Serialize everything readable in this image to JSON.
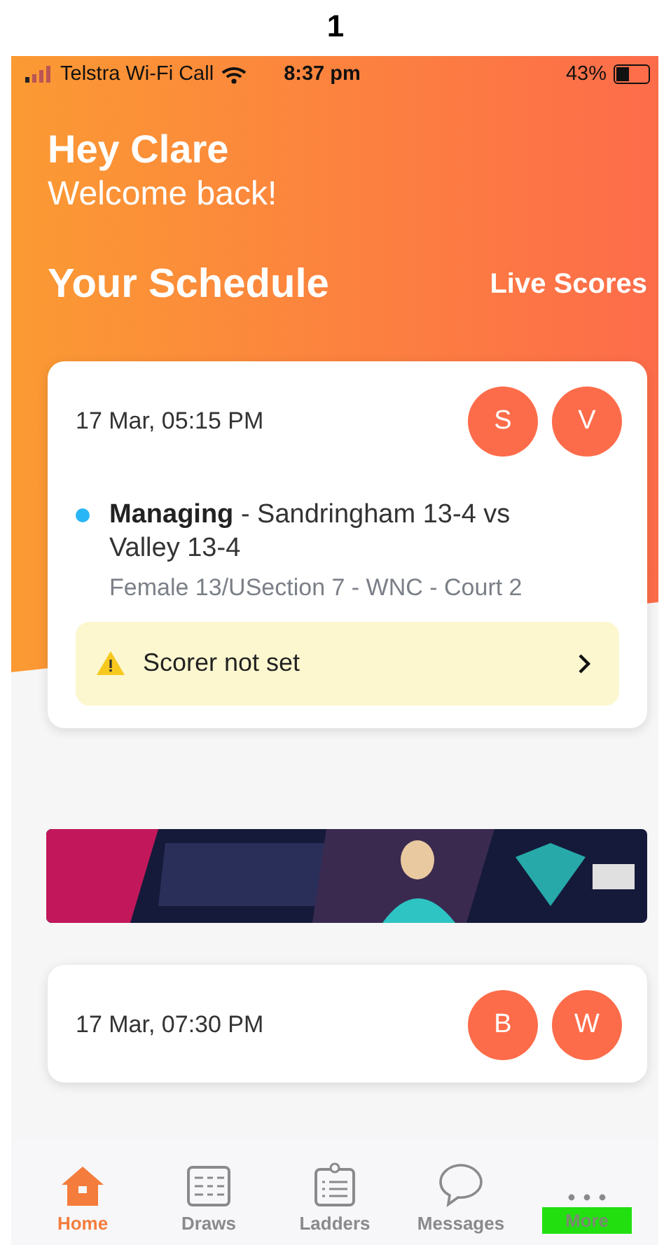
{
  "figure_label": "1",
  "status_bar": {
    "carrier": "Telstra Wi-Fi Call",
    "time": "8:37 pm",
    "battery": "43%"
  },
  "greeting": {
    "title": "Hey Clare",
    "subtitle": "Welcome back!"
  },
  "schedule": {
    "title": "Your Schedule",
    "link": "Live Scores"
  },
  "matches": [
    {
      "datetime": "17 Mar, 05:15 PM",
      "teams": [
        "S",
        "V"
      ],
      "color": "#29b6f6",
      "role": "Managing",
      "fixture": " - Sandringham 13-4 vs Valley 13-4",
      "details": "Female 13/USection 7 - WNC - Court 2",
      "alert": "Scorer not set"
    },
    {
      "datetime": "17 Mar, 07:30 PM",
      "teams": [
        "B",
        "W"
      ]
    }
  ],
  "tabs": [
    {
      "label": "Home",
      "kind": "home",
      "selected": true,
      "highlighted": false
    },
    {
      "label": "Draws",
      "kind": "draws",
      "selected": false,
      "highlighted": false
    },
    {
      "label": "Ladders",
      "kind": "ladders",
      "selected": false,
      "highlighted": false
    },
    {
      "label": "Messages",
      "kind": "messages",
      "selected": false,
      "highlighted": false
    },
    {
      "label": "More",
      "kind": "more",
      "selected": false,
      "highlighted": true
    }
  ]
}
